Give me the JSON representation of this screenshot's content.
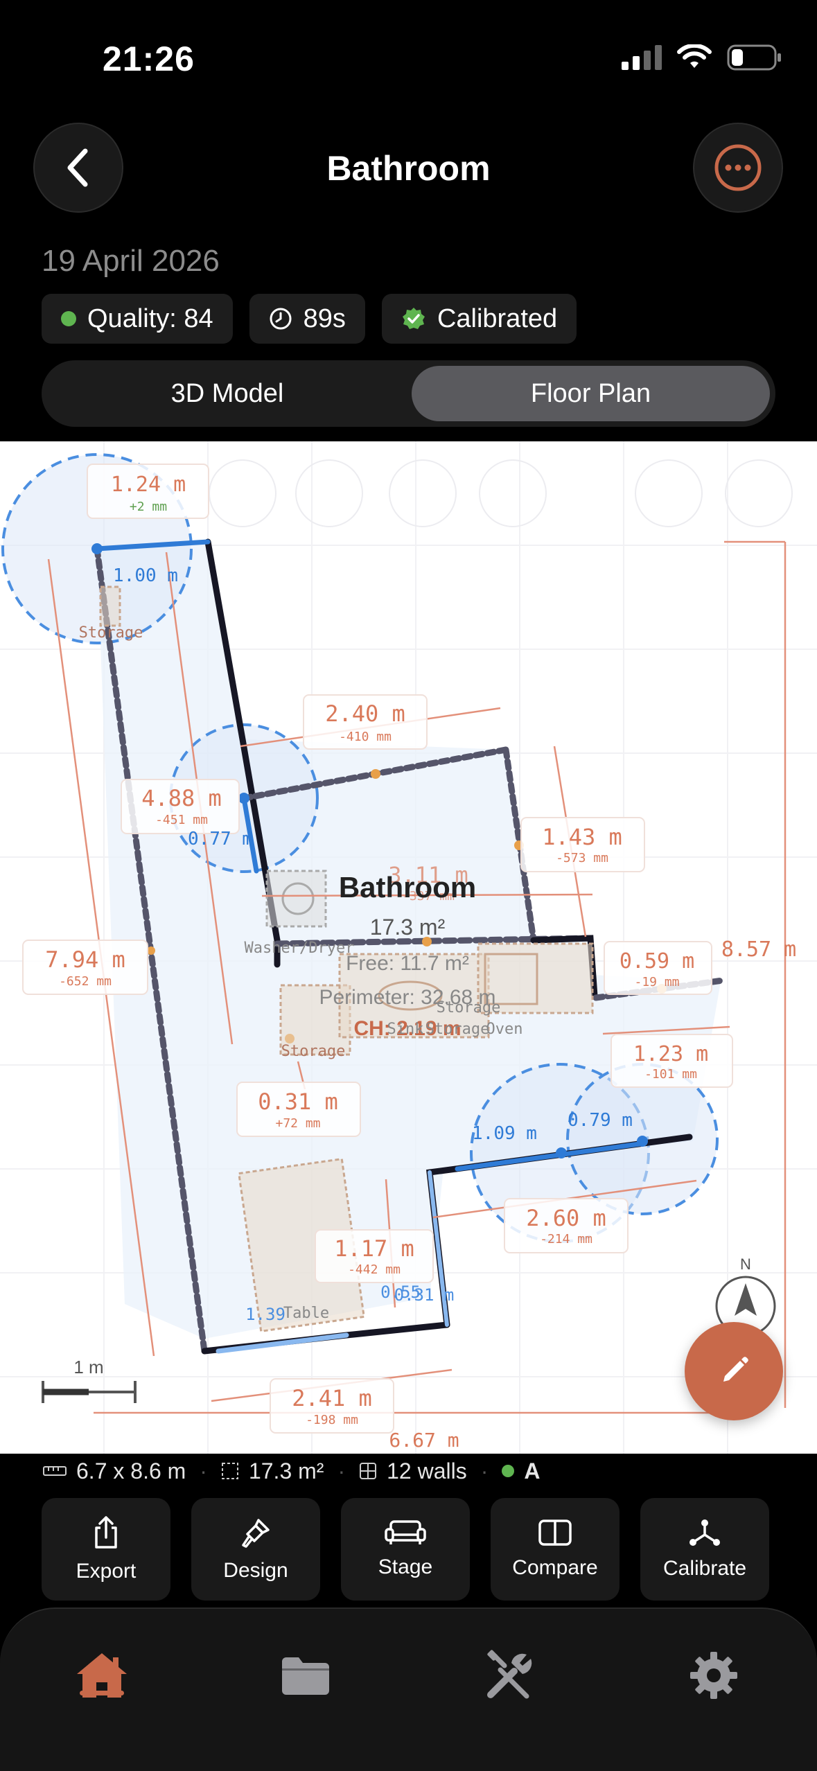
{
  "status": {
    "time": "21:26"
  },
  "header": {
    "title": "Bathroom",
    "date": "19 April 2026"
  },
  "chips": {
    "quality": "Quality: 84",
    "duration": "89s",
    "calibrated": "Calibrated"
  },
  "view_toggle": {
    "model": "3D Model",
    "floor_plan": "Floor Plan",
    "selected": "Floor Plan"
  },
  "plan": {
    "room_name": "Bathroom",
    "room_area": "17.3 m²",
    "free_area": "Free: 11.7 m²",
    "perimeter": "Perimeter: 32.68 m",
    "ceiling_height": "CH: 2.19 m",
    "scale_label": "1 m",
    "compass": "N",
    "objects": [
      "Storage",
      "Washer/Dryer",
      "Storage",
      "Storage",
      "Sink",
      "Storage",
      "Oven",
      "Table"
    ],
    "dimensions": [
      {
        "value": "1.24 m",
        "delta": "+2 mm"
      },
      {
        "value": "1.00 m"
      },
      {
        "value": "2.40 m",
        "delta": "-410 mm"
      },
      {
        "value": "4.88 m",
        "delta": "-451 mm"
      },
      {
        "value": "0.77 m"
      },
      {
        "value": "1.43 m",
        "delta": "-573 mm"
      },
      {
        "value": "3.11 m",
        "delta": "-337 mm"
      },
      {
        "value": "7.94 m",
        "delta": "-652 mm"
      },
      {
        "value": "0.59 m",
        "delta": "-19 mm"
      },
      {
        "value": "8.57 m"
      },
      {
        "value": "0.31 m",
        "delta": "+72 mm"
      },
      {
        "value": "1.23 m",
        "delta": "-101 mm"
      },
      {
        "value": "1.09 m"
      },
      {
        "value": "0.79 m"
      },
      {
        "value": "2.60 m",
        "delta": "-214 mm"
      },
      {
        "value": "1.17 m",
        "delta": "-442 mm"
      },
      {
        "value": "0.55"
      },
      {
        "value": "0.31 m"
      },
      {
        "value": "1.39"
      },
      {
        "value": "2.41 m",
        "delta": "-198 mm"
      },
      {
        "value": "6.67 m"
      }
    ]
  },
  "stats": {
    "size": "6.7 x 8.6 m",
    "area": "17.3 m²",
    "walls": "12 walls",
    "grade": "A"
  },
  "actions": [
    "Export",
    "Design",
    "Stage",
    "Compare",
    "Calibrate"
  ],
  "tabs": [
    "home-icon",
    "folder-icon",
    "tools-icon",
    "gear-icon"
  ],
  "colors": {
    "accent": "#c8694a",
    "dimension": "#d9795a",
    "wall": "#1a1a2e",
    "selection": "#3a7bd5",
    "good": "#5fb550"
  }
}
